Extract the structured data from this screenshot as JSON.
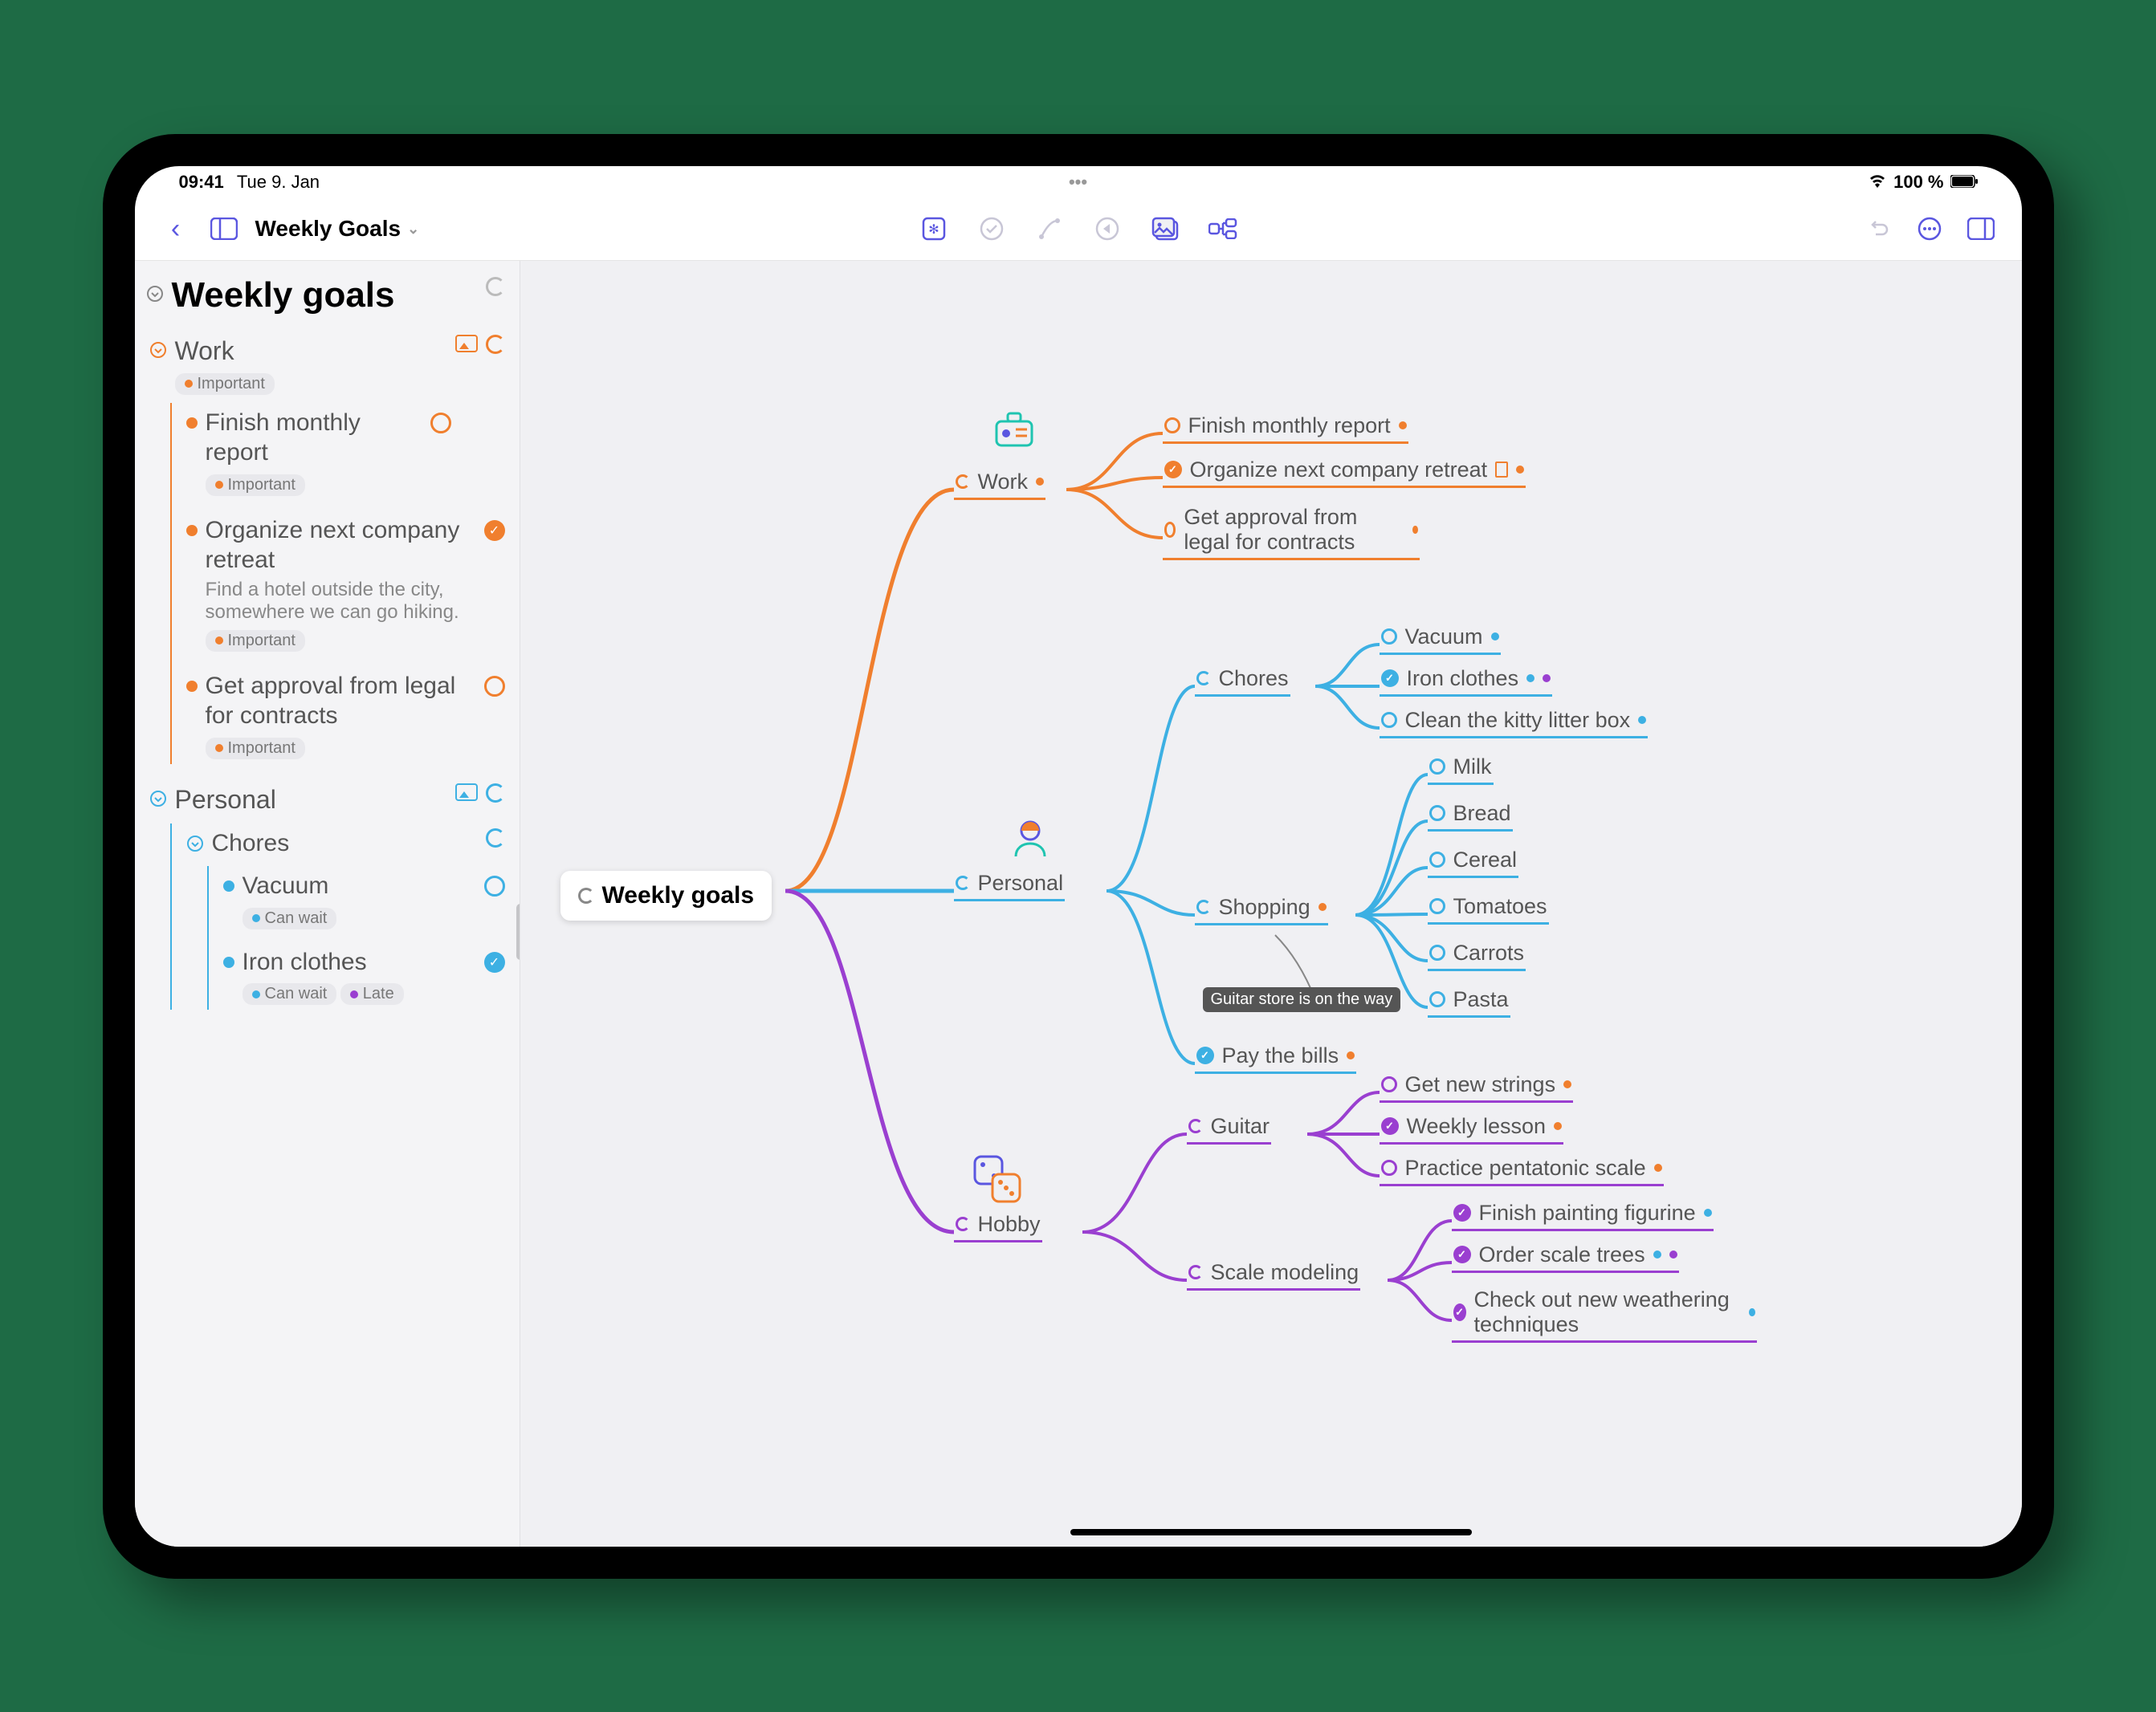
{
  "status": {
    "time": "09:41",
    "date": "Tue 9. Jan",
    "battery": "100 %"
  },
  "toolbar": {
    "title": "Weekly Goals"
  },
  "colors": {
    "orange": "#f07f2e",
    "blue": "#3db0e3",
    "purple": "#9a3fd0",
    "indigo": "#5a56e0",
    "grey": "#9d9d9d"
  },
  "tags": {
    "important": "Important",
    "canwait": "Can wait",
    "late": "Late"
  },
  "tooltip": "Guitar store is on the way",
  "sidebar": {
    "title": "Weekly goals",
    "work": {
      "label": "Work",
      "items": [
        {
          "label": "Finish monthly report"
        },
        {
          "label": "Organize next company retreat",
          "note": "Find a hotel outside the city, somewhere we can go hiking."
        },
        {
          "label": "Get approval from legal for contracts"
        }
      ]
    },
    "personal": {
      "label": "Personal",
      "chores": {
        "label": "Chores",
        "items": [
          {
            "label": "Vacuum"
          },
          {
            "label": "Iron clothes"
          }
        ]
      }
    }
  },
  "mm": {
    "root": "Weekly goals",
    "work": {
      "label": "Work",
      "items": [
        "Finish monthly report",
        "Organize next company retreat",
        "Get approval from legal for contracts"
      ]
    },
    "personal": {
      "label": "Personal",
      "chores": {
        "label": "Chores",
        "items": [
          "Vacuum",
          "Iron clothes",
          "Clean the kitty litter box"
        ]
      },
      "shopping": {
        "label": "Shopping",
        "items": [
          "Milk",
          "Bread",
          "Cereal",
          "Tomatoes",
          "Carrots",
          "Pasta"
        ]
      },
      "paybills": "Pay the bills"
    },
    "hobby": {
      "label": "Hobby",
      "guitar": {
        "label": "Guitar",
        "items": [
          "Get new strings",
          "Weekly lesson",
          "Practice pentatonic scale"
        ]
      },
      "scale": {
        "label": "Scale modeling",
        "items": [
          "Finish painting figurine",
          "Order scale trees",
          "Check out new weathering techniques"
        ]
      }
    }
  }
}
